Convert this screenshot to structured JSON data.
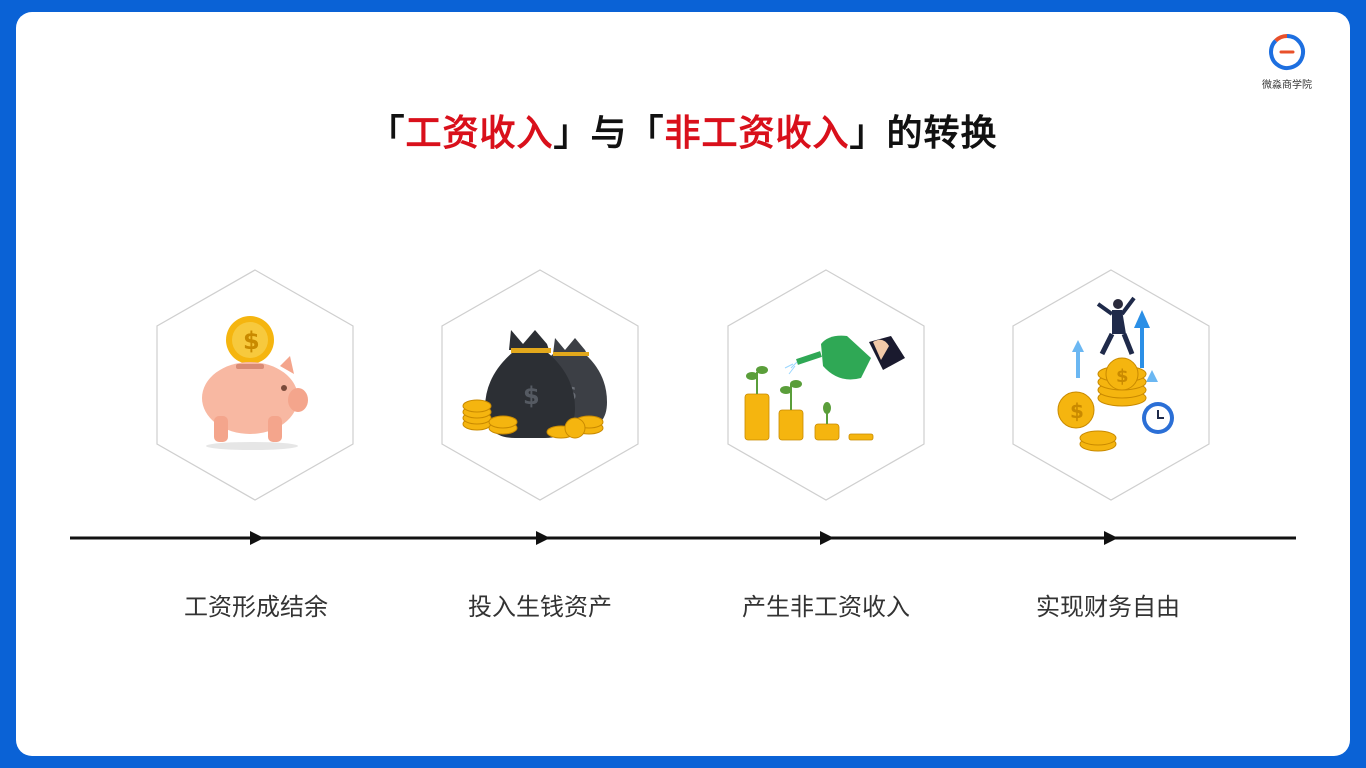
{
  "brand": {
    "name": "微淼商学院",
    "logo_icon": "brand-logo-icon"
  },
  "title": {
    "b1": "「",
    "p1": "工资收入",
    "b2": "」",
    "mid": "与",
    "b3": "「",
    "p2": "非工资收入",
    "b4": "」",
    "end": "的转换"
  },
  "steps": [
    {
      "label": "工资形成结余",
      "icon": "piggy-bank-icon"
    },
    {
      "label": "投入生钱资产",
      "icon": "money-bags-icon"
    },
    {
      "label": "产生非工资收入",
      "icon": "watering-coins-icon"
    },
    {
      "label": "实现财务自由",
      "icon": "financial-freedom-icon"
    }
  ],
  "colors": {
    "accent": "#d9101b",
    "border": "#0a62d6",
    "coin": "#f5b50f"
  }
}
